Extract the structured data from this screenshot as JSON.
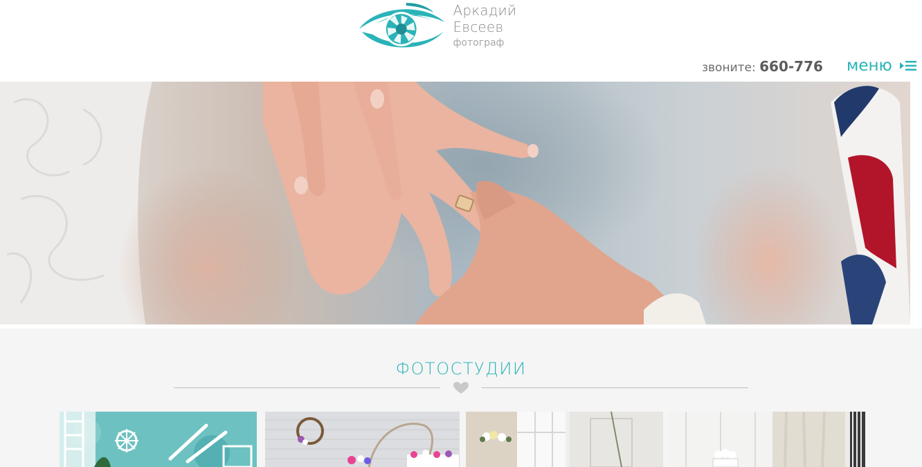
{
  "header": {
    "logo": {
      "name": "Аркадий Евсеев",
      "subtitle": "фотограф",
      "icon": "eye-aperture-icon",
      "accent_color": "#2ab3b8"
    },
    "phone": {
      "label": "звоните:",
      "number": "660-776"
    },
    "menu": {
      "label": "меню",
      "icon": "menu-list-icon"
    }
  },
  "hero": {
    "image": "wedding-ring-hands-photo"
  },
  "studios": {
    "title": "ФОТОСТУДИИ",
    "divider_icon": "heart-icon",
    "items": [
      {
        "image": "studio-turquoise-marine"
      },
      {
        "image": "studio-white-brick-wreath"
      },
      {
        "image": "studio-white-flowers-window"
      },
      {
        "image": "studio-white-curtains"
      }
    ]
  },
  "colors": {
    "accent": "#2ab3b8",
    "text_gray": "#8a8a8a",
    "section_bg": "#f5f5f5"
  }
}
